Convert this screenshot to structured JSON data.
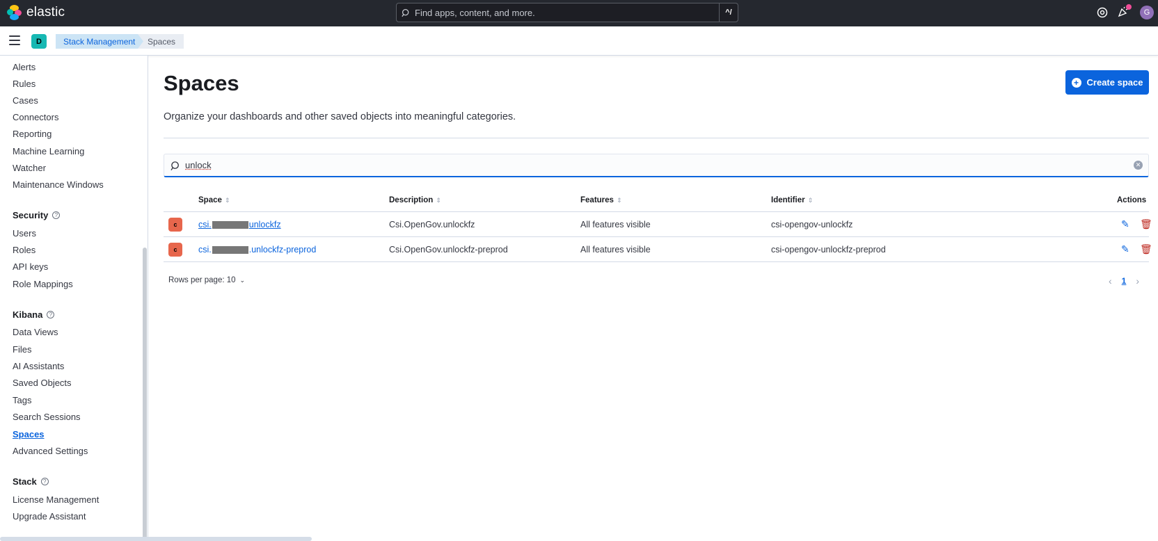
{
  "header": {
    "brand": "elastic",
    "search_placeholder": "Find apps, content, and more.",
    "search_shortcut": "^/",
    "user_initial": "G",
    "colors": {
      "bg": "#25282f",
      "avatar": "#9170b8"
    }
  },
  "breadcrumbs": {
    "space_initial": "D",
    "items": [
      "Stack Management",
      "Spaces"
    ]
  },
  "sidebar": {
    "top_items": [
      "Alerts",
      "Rules",
      "Cases",
      "Connectors",
      "Reporting",
      "Machine Learning",
      "Watcher",
      "Maintenance Windows"
    ],
    "security": {
      "title": "Security",
      "items": [
        "Users",
        "Roles",
        "API keys",
        "Role Mappings"
      ]
    },
    "kibana": {
      "title": "Kibana",
      "items": [
        "Data Views",
        "Files",
        "AI Assistants",
        "Saved Objects",
        "Tags",
        "Search Sessions",
        "Spaces",
        "Advanced Settings"
      ]
    },
    "stack": {
      "title": "Stack",
      "items": [
        "License Management",
        "Upgrade Assistant"
      ]
    },
    "active": "Spaces"
  },
  "main": {
    "title": "Spaces",
    "description": "Organize your dashboards and other saved objects into meaningful categories.",
    "create_button": "Create space",
    "search_value": "unlock",
    "table": {
      "columns": [
        "Space",
        "Description",
        "Features",
        "Identifier",
        "Actions"
      ],
      "rows": [
        {
          "avatar": "c",
          "space_prefix": "csi.",
          "space_suffix": "unlockfz",
          "description": "Csi.OpenGov.unlockfz",
          "features": "All features visible",
          "identifier": "csi-opengov-unlockfz"
        },
        {
          "avatar": "c",
          "space_prefix": "csi.",
          "space_suffix": ".unlockfz-preprod",
          "description": "Csi.OpenGov.unlockfz-preprod",
          "features": "All features visible",
          "identifier": "csi-opengov-unlockfz-preprod"
        }
      ]
    },
    "rows_per_page": "Rows per page: 10",
    "current_page": "1",
    "colors": {
      "primary": "#0b64dd",
      "danger": "#bd271e",
      "space_avatar": "#e7664c"
    }
  }
}
